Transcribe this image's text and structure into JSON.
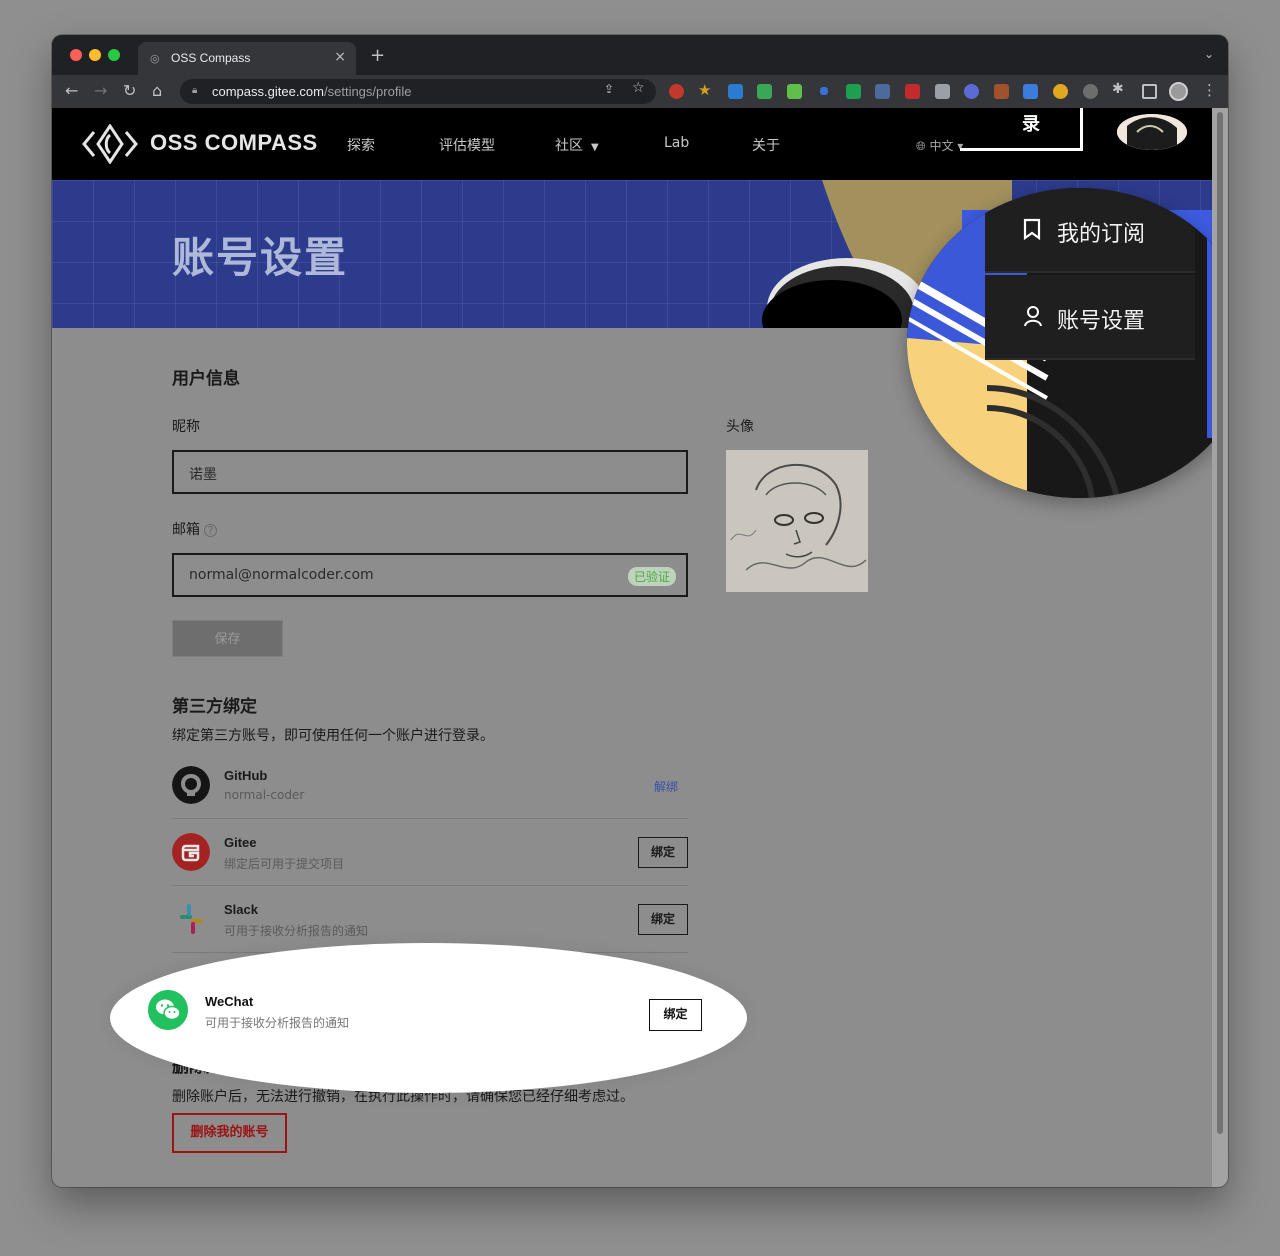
{
  "browser": {
    "tab_title": "OSS Compass",
    "new_tab": "+",
    "close": "×",
    "url_host": "compass.gitee.com",
    "url_path": "/settings/profile"
  },
  "site_nav": {
    "brand": "OSS COMPASS",
    "links": [
      "探索",
      "评估模型",
      "社区",
      "Lab",
      "关于"
    ],
    "language": "中文",
    "login_fragment": "录"
  },
  "banner": {
    "title": "账号设置"
  },
  "user_info": {
    "heading": "用户信息",
    "nickname_label": "昵称",
    "nickname_value": "诺墨",
    "email_label": "邮箱",
    "email_value": "normal@normalcoder.com",
    "email_status": "已验证",
    "save_label": "保存",
    "avatar_label": "头像"
  },
  "third_party": {
    "heading": "第三方绑定",
    "description": "绑定第三方账号，即可使用任何一个账户进行登录。",
    "accounts": [
      {
        "name": "GitHub",
        "sub": "normal-coder",
        "action": "解绑"
      },
      {
        "name": "Gitee",
        "sub": "绑定后可用于提交项目",
        "action": "绑定"
      },
      {
        "name": "Slack",
        "sub": "可用于接收分析报告的通知",
        "action": "绑定"
      },
      {
        "name": "WeChat",
        "sub": "可用于接收分析报告的通知",
        "action": "绑定"
      }
    ]
  },
  "delete_account": {
    "heading": "删除账号",
    "description": "删除账户后，无法进行撤销，在执行此操作时，请确保您已经仔细考虑过。",
    "button": "删除我的账号"
  },
  "user_menu": {
    "items": [
      {
        "label": "我的订阅",
        "icon": "bookmark-icon"
      },
      {
        "label": "账号设置",
        "icon": "user-icon"
      }
    ]
  },
  "colors": {
    "banner": "#2c3b8c",
    "wechat": "#22c160",
    "danger": "#9b1313",
    "verified": "#4cab46"
  }
}
